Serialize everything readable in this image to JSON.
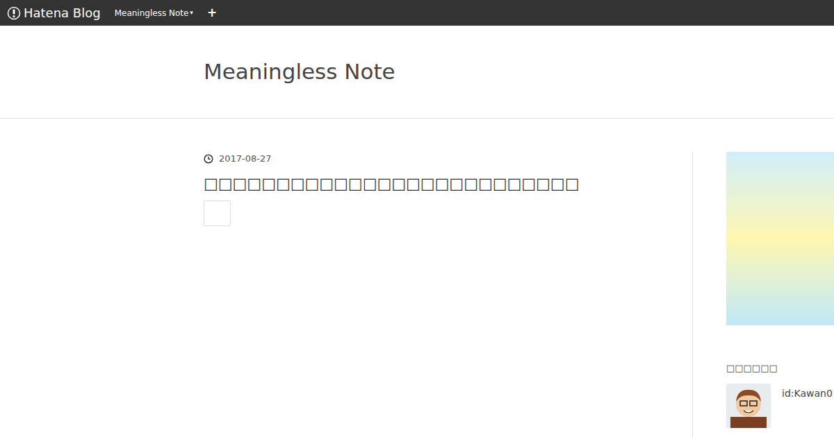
{
  "topbar": {
    "logo": "Hatena Blog",
    "blog_menu": "Meaningless Note",
    "blog_menu_arrow": "▾",
    "add": "+"
  },
  "blog_title": "Meaningless Note",
  "entry": {
    "date": "2017-08-27",
    "title": "□□□□□□□□□□□□□□□□□□□□□□□□□□"
  },
  "sidebar": {
    "profile_heading": "□□□□□□",
    "profile_id": "id:Kawan0"
  }
}
